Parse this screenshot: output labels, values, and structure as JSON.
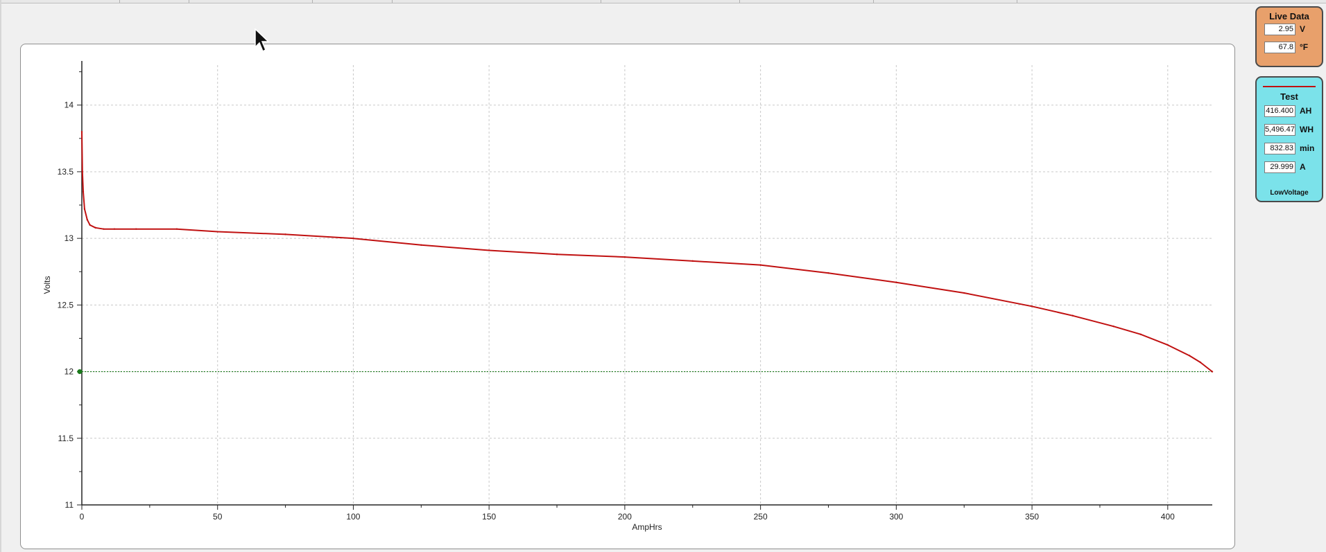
{
  "live_data": {
    "title": "Live Data",
    "volts": {
      "value": "2.95",
      "unit": "V"
    },
    "temperature": {
      "value": "67.8",
      "unit": "°F"
    }
  },
  "test": {
    "title": "Test",
    "line_color": "#c01010",
    "amp_hours": {
      "value": "416.400",
      "unit": "AH"
    },
    "watt_hours": {
      "value": "5,496.47",
      "unit": "WH"
    },
    "minutes": {
      "value": "832.83",
      "unit": "min"
    },
    "amps": {
      "value": "29.999",
      "unit": "A"
    },
    "status": "LowVoltage"
  },
  "colors": {
    "live_panel": "#e8a06b",
    "test_panel": "#7be2ea",
    "series": "#c01010",
    "cutoff": "#1a7a1a"
  },
  "chart_data": {
    "type": "line",
    "xlabel": "AmpHrs",
    "ylabel": "Volts",
    "xlim": [
      0,
      416.4
    ],
    "ylim": [
      11,
      14.3
    ],
    "x_ticks": [
      0,
      50,
      100,
      150,
      200,
      250,
      300,
      350,
      400
    ],
    "y_ticks": [
      11,
      11.5,
      12,
      12.5,
      13,
      13.5,
      14
    ],
    "grid": true,
    "series": [
      {
        "name": "Test",
        "color": "#c01010",
        "x": [
          0,
          0.2,
          0.5,
          1,
          2,
          3,
          5,
          8,
          12,
          20,
          35,
          50,
          75,
          100,
          125,
          150,
          175,
          200,
          225,
          250,
          275,
          300,
          325,
          350,
          365,
          380,
          390,
          400,
          408,
          412,
          416.4
        ],
        "y": [
          13.8,
          13.5,
          13.35,
          13.22,
          13.14,
          13.1,
          13.08,
          13.07,
          13.07,
          13.07,
          13.07,
          13.05,
          13.03,
          13.0,
          12.95,
          12.91,
          12.88,
          12.86,
          12.83,
          12.8,
          12.74,
          12.67,
          12.59,
          12.49,
          12.42,
          12.34,
          12.28,
          12.2,
          12.12,
          12.07,
          12.0
        ]
      }
    ],
    "reference_lines": [
      {
        "y": 12.0,
        "color": "#1a7a1a",
        "style": "dotted"
      }
    ]
  }
}
